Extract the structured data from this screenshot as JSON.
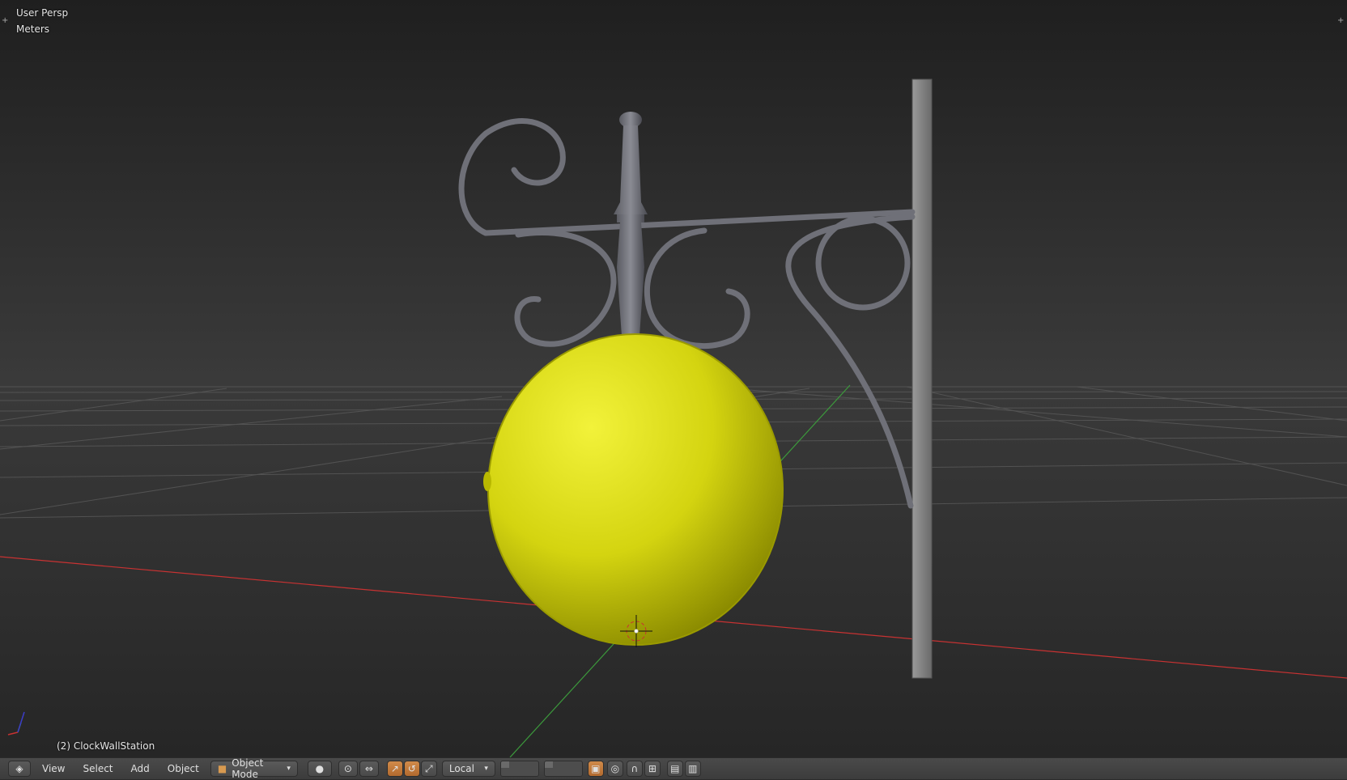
{
  "viewport": {
    "view_name": "User Persp",
    "units": "Meters",
    "object_label": "(2) ClockWallStation"
  },
  "toolbar": {
    "menus": [
      "View",
      "Select",
      "Add",
      "Object"
    ],
    "mode": "Object Mode",
    "orientation": "Local"
  },
  "colors": {
    "clock_face": "#d4d410",
    "ironwork": "#6f7078",
    "post": "#8a8a8a",
    "x_axis": "#c83232",
    "y_axis": "#3c9a3c",
    "active_button": "#c77a3a"
  }
}
